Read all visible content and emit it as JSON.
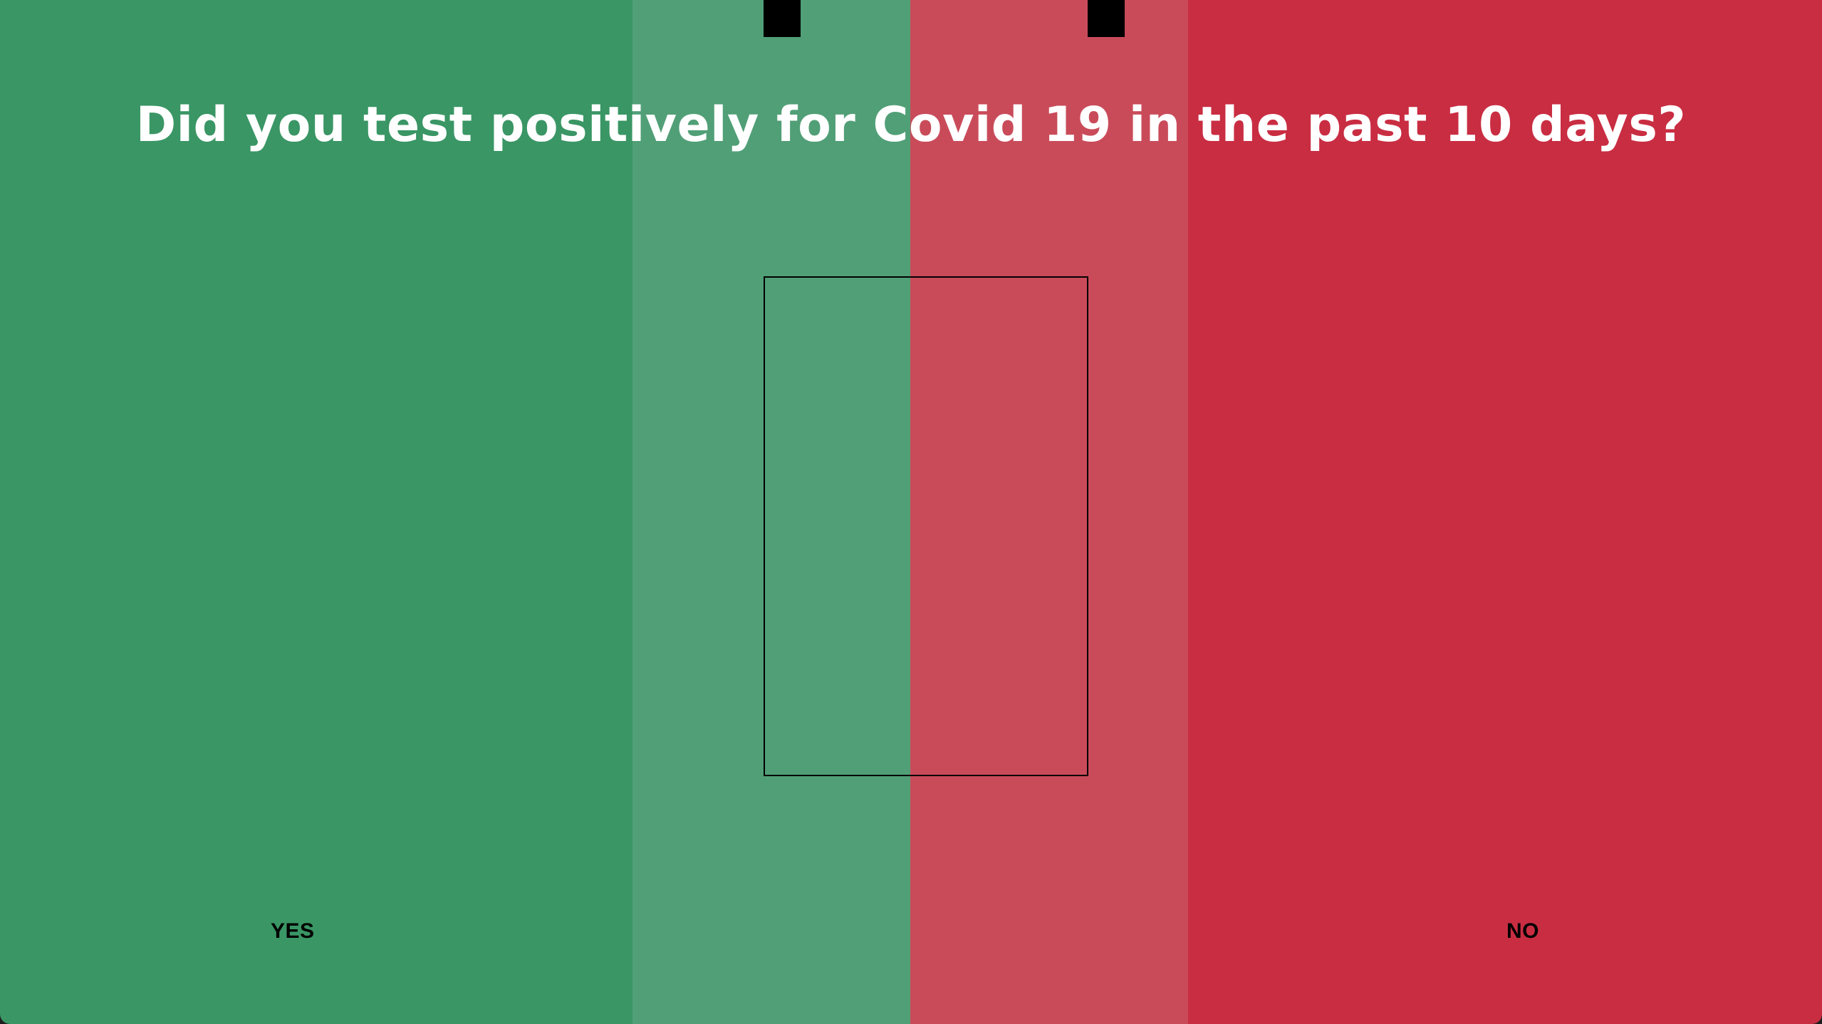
{
  "question": {
    "text": "Did you test positively for Covid 19 in the past 10 days?"
  },
  "answers": {
    "yes_label": "YES",
    "no_label": "NO"
  },
  "colors": {
    "yes_zone": "#3a9665",
    "yes_soft_zone": "#519f77",
    "no_soft_zone": "#c94b5a",
    "no_zone": "#c92d42",
    "text": "#ffffff",
    "label_text": "#000000",
    "frame": "#000000"
  }
}
